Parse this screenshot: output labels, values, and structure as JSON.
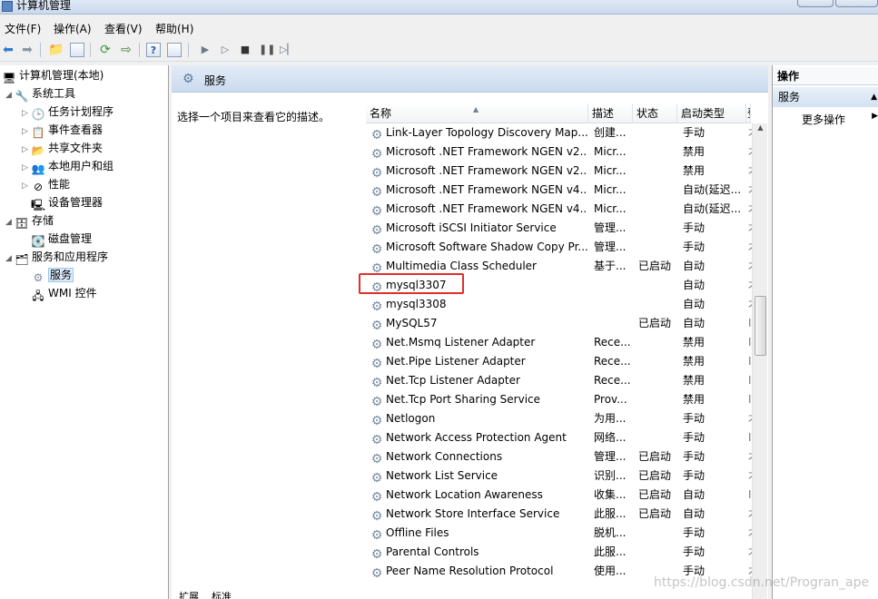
{
  "window": {
    "title": "计算机管理"
  },
  "menu": [
    "文件(F)",
    "操作(A)",
    "查看(V)",
    "帮助(H)"
  ],
  "tree": {
    "root": "计算机管理(本地)",
    "system_tools": "系统工具",
    "task_scheduler": "任务计划程序",
    "event_viewer": "事件查看器",
    "shared_folders": "共享文件夹",
    "local_users": "本地用户和组",
    "performance": "性能",
    "device_manager": "设备管理器",
    "storage": "存储",
    "disk_management": "磁盘管理",
    "services_apps": "服务和应用程序",
    "services": "服务",
    "wmi": "WMI 控件"
  },
  "center": {
    "header": "服务",
    "description_hint": "选择一个项目来查看它的描述。",
    "columns": {
      "name": "名称",
      "description": "描述",
      "status": "状态",
      "startup": "启动类型",
      "logon": "登"
    },
    "rows": [
      {
        "name": "Link-Layer Topology Discovery Map...",
        "desc": "创建...",
        "status": "",
        "start": "手动",
        "cut": "才"
      },
      {
        "name": "Microsoft .NET Framework NGEN v2...",
        "desc": "Micr...",
        "status": "",
        "start": "禁用",
        "cut": "才"
      },
      {
        "name": "Microsoft .NET Framework NGEN v2...",
        "desc": "Micr...",
        "status": "",
        "start": "禁用",
        "cut": "才"
      },
      {
        "name": "Microsoft .NET Framework NGEN v4...",
        "desc": "Micr...",
        "status": "",
        "start": "自动(延迟...",
        "cut": "才"
      },
      {
        "name": "Microsoft .NET Framework NGEN v4...",
        "desc": "Micr...",
        "status": "",
        "start": "自动(延迟...",
        "cut": "才"
      },
      {
        "name": "Microsoft iSCSI Initiator Service",
        "desc": "管理...",
        "status": "",
        "start": "手动",
        "cut": "才"
      },
      {
        "name": "Microsoft Software Shadow Copy Pr...",
        "desc": "管理...",
        "status": "",
        "start": "手动",
        "cut": "才"
      },
      {
        "name": "Multimedia Class Scheduler",
        "desc": "基于...",
        "status": "已启动",
        "start": "自动",
        "cut": "才"
      },
      {
        "name": "mysql3307",
        "desc": "",
        "status": "",
        "start": "自动",
        "cut": "才"
      },
      {
        "name": "mysql3308",
        "desc": "",
        "status": "",
        "start": "自动",
        "cut": "才"
      },
      {
        "name": "MySQL57",
        "desc": "",
        "status": "已启动",
        "start": "自动",
        "cut": "I"
      },
      {
        "name": "Net.Msmq Listener Adapter",
        "desc": "Rece...",
        "status": "",
        "start": "禁用",
        "cut": "I"
      },
      {
        "name": "Net.Pipe Listener Adapter",
        "desc": "Rece...",
        "status": "",
        "start": "禁用",
        "cut": "I"
      },
      {
        "name": "Net.Tcp Listener Adapter",
        "desc": "Rece...",
        "status": "",
        "start": "禁用",
        "cut": "I"
      },
      {
        "name": "Net.Tcp Port Sharing Service",
        "desc": "Prov...",
        "status": "",
        "start": "禁用",
        "cut": "I"
      },
      {
        "name": "Netlogon",
        "desc": "为用...",
        "status": "",
        "start": "手动",
        "cut": "才"
      },
      {
        "name": "Network Access Protection Agent",
        "desc": "网络...",
        "status": "",
        "start": "手动",
        "cut": "I"
      },
      {
        "name": "Network Connections",
        "desc": "管理...",
        "status": "已启动",
        "start": "手动",
        "cut": "才"
      },
      {
        "name": "Network List Service",
        "desc": "识别...",
        "status": "已启动",
        "start": "手动",
        "cut": "才"
      },
      {
        "name": "Network Location Awareness",
        "desc": "收集...",
        "status": "已启动",
        "start": "自动",
        "cut": "I"
      },
      {
        "name": "Network Store Interface Service",
        "desc": "此服...",
        "status": "已启动",
        "start": "自动",
        "cut": "才"
      },
      {
        "name": "Offline Files",
        "desc": "脱机...",
        "status": "",
        "start": "手动",
        "cut": "才"
      },
      {
        "name": "Parental Controls",
        "desc": "此服...",
        "status": "",
        "start": "手动",
        "cut": "才"
      },
      {
        "name": "Peer Name Resolution Protocol",
        "desc": "使用...",
        "status": "",
        "start": "手动",
        "cut": "才"
      }
    ]
  },
  "actions": {
    "title": "操作",
    "group": "服务",
    "more": "更多操作"
  },
  "bottom_tabs": [
    "扩展",
    "标准"
  ],
  "watermark": "https://blog.csdn.net/Progran_ape"
}
